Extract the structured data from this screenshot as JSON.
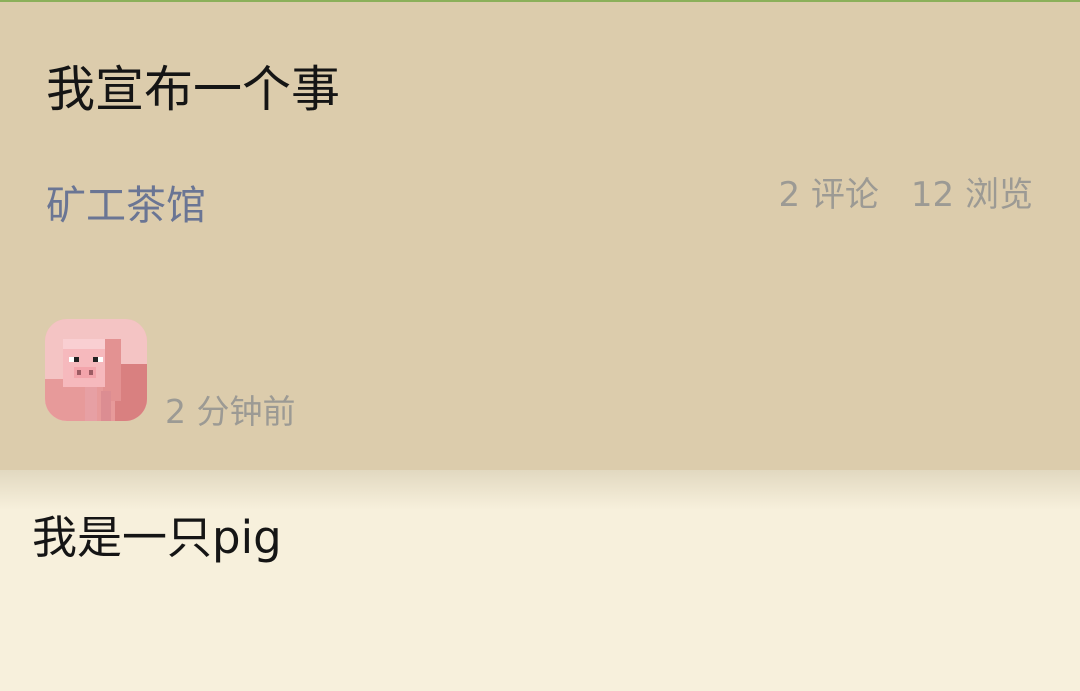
{
  "post": {
    "title": "我宣布一个事",
    "forum": "矿工茶馆",
    "comments": "2 评论",
    "views": "12 浏览",
    "time": "2 分钟前",
    "content": "我是一只pig"
  },
  "avatar": {
    "icon": "minecraft-pig-icon"
  },
  "colors": {
    "header_bg": "#dcccac",
    "body_bg": "#f7f0dc",
    "forum_link": "#6a7594",
    "meta_text": "#9c9a94",
    "top_accent": "#8bb05a"
  }
}
